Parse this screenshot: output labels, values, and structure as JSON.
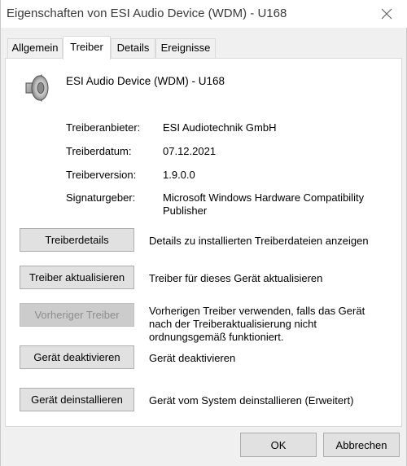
{
  "window": {
    "title": "Eigenschaften von ESI Audio Device (WDM) - U168",
    "close_icon": "close-icon"
  },
  "tabs": [
    {
      "label": "Allgemein",
      "active": false
    },
    {
      "label": "Treiber",
      "active": true
    },
    {
      "label": "Details",
      "active": false
    },
    {
      "label": "Ereignisse",
      "active": false
    }
  ],
  "device": {
    "icon": "speaker-icon",
    "name": "ESI Audio Device (WDM) - U168"
  },
  "driver_info": [
    {
      "label": "Treiberanbieter:",
      "value": "ESI Audiotechnik GmbH"
    },
    {
      "label": "Treiberdatum:",
      "value": "07.12.2021"
    },
    {
      "label": "Treiberversion:",
      "value": "1.9.0.0"
    },
    {
      "label": "Signaturgeber:",
      "value": "Microsoft Windows Hardware Compatibility Publisher"
    }
  ],
  "actions": [
    {
      "button": "Treiberdetails",
      "description": "Details zu installierten Treiberdateien anzeigen",
      "enabled": true
    },
    {
      "button": "Treiber aktualisieren",
      "description": "Treiber für dieses Gerät aktualisieren",
      "enabled": true
    },
    {
      "button": "Vorheriger Treiber",
      "description": "Vorherigen Treiber verwenden, falls das Gerät nach der Treiberaktualisierung nicht ordnungsgemäß funktioniert.",
      "enabled": false
    },
    {
      "button": "Gerät deaktivieren",
      "description": "Gerät deaktivieren",
      "enabled": true
    },
    {
      "button": "Gerät deinstallieren",
      "description": "Gerät vom System deinstallieren (Erweitert)",
      "enabled": true
    }
  ],
  "footer": {
    "ok_label": "OK",
    "cancel_label": "Abbrechen"
  }
}
